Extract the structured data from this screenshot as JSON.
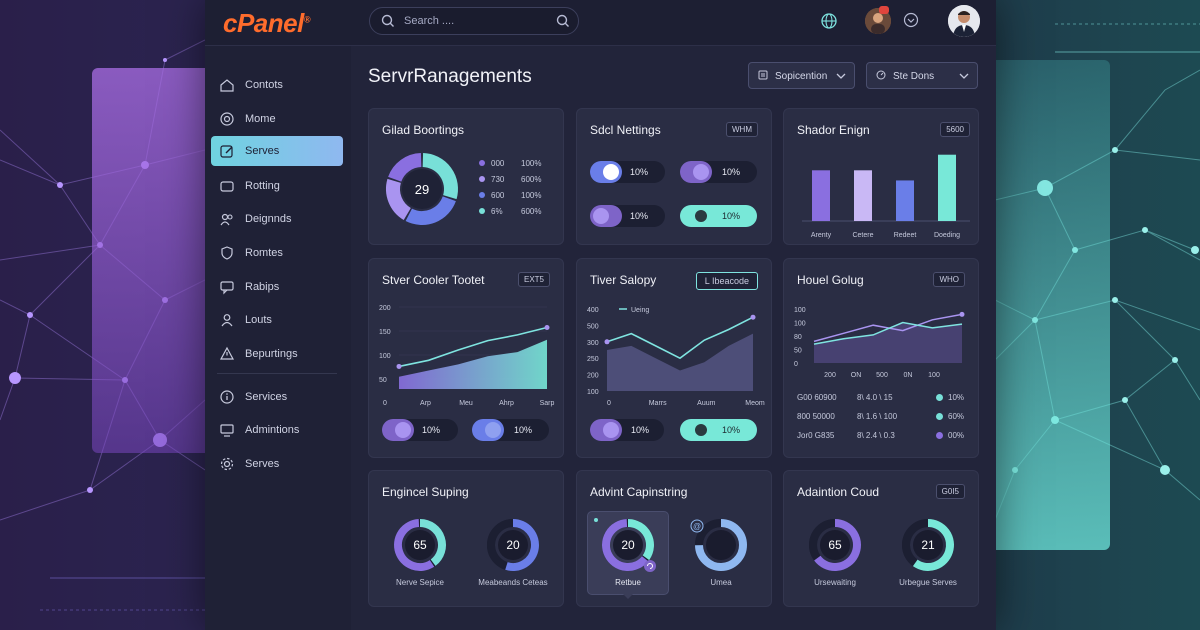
{
  "app": {
    "logo": "cPanel"
  },
  "search": {
    "placeholder": "Search ...."
  },
  "sidebar": {
    "items": [
      {
        "label": "Contots",
        "icon": "home-icon"
      },
      {
        "label": "Mome",
        "icon": "target-icon"
      },
      {
        "label": "Serves",
        "icon": "edit-icon",
        "active": true
      },
      {
        "label": "Rotting",
        "icon": "folder-icon"
      },
      {
        "label": "Deignnds",
        "icon": "people-icon"
      },
      {
        "label": "Romtes",
        "icon": "shield-icon"
      },
      {
        "label": "Rabips",
        "icon": "chat-icon"
      },
      {
        "label": "Louts",
        "icon": "user-icon"
      },
      {
        "label": "Bepurtings",
        "icon": "warning-icon"
      },
      {
        "label": "Services",
        "icon": "info-icon"
      },
      {
        "label": "Admintions",
        "icon": "monitor-icon"
      },
      {
        "label": "Serves",
        "icon": "gear-icon"
      }
    ]
  },
  "header": {
    "title": "ServrRanagements",
    "dropdown1": "Sopicention",
    "dropdown2": "Ste Dons"
  },
  "cards": {
    "c1": {
      "title": "Gilad Boortings",
      "center": "29",
      "legend": [
        {
          "a": "000",
          "b": "100%",
          "color": "#8a6fe0"
        },
        {
          "a": "730",
          "b": "600%",
          "color": "#a994f0"
        },
        {
          "a": "600",
          "b": "100%",
          "color": "#6a7ee8"
        },
        {
          "a": "6%",
          "b": "600%",
          "color": "#78e0d8"
        }
      ],
      "donut": [
        0.3,
        0.28,
        0.22,
        0.2
      ]
    },
    "c2": {
      "title": "Sdcl Nettings",
      "badge": "WHM",
      "toggles": [
        "10%",
        "10%",
        "10%",
        "10%"
      ]
    },
    "c3": {
      "title": "Shador Enign",
      "badge": "5600",
      "chart_data": {
        "type": "bar",
        "categories": [
          "Arenty",
          "Cetere",
          "Redeet",
          "Doeding"
        ],
        "values": [
          65,
          65,
          52,
          85
        ],
        "ylim": [
          0,
          100
        ]
      }
    },
    "c4": {
      "title": "Stver Cooler Tootet",
      "badge": "EXT5",
      "chart_data": {
        "type": "area",
        "yticks": [
          "200",
          "150",
          "100",
          "50"
        ],
        "xticks": [
          "0",
          "Arp",
          "Meu",
          "Ahrp",
          "Sarp"
        ],
        "line": [
          55,
          70,
          95,
          118,
          132,
          150
        ],
        "area": [
          30,
          45,
          60,
          80,
          90,
          120
        ],
        "ylim": [
          0,
          200
        ]
      },
      "toggles": [
        "10%",
        "10%"
      ]
    },
    "c5": {
      "title": "Tiver Salopy",
      "badge": "L Ibeacode",
      "chart_data": {
        "type": "area",
        "yticks": [
          "400",
          "500",
          "300",
          "250",
          "200",
          "100"
        ],
        "xticks": [
          "0",
          "Marrs",
          "Auum",
          "Meom"
        ],
        "legend": "Ueing",
        "line": [
          60,
          70,
          55,
          40,
          62,
          75,
          90
        ],
        "area": [
          50,
          55,
          40,
          25,
          35,
          55,
          70
        ]
      },
      "toggles": [
        "10%",
        "10%"
      ]
    },
    "c6": {
      "title": "Houel Golug",
      "badge": "WHO",
      "chart_data": {
        "type": "line",
        "yticks": [
          "100",
          "100",
          "80",
          "50",
          "0"
        ],
        "xticks": [
          "200",
          "ON",
          "500",
          "0N",
          "100"
        ],
        "line1": [
          40,
          55,
          70,
          60,
          80,
          90
        ],
        "line2": [
          35,
          45,
          52,
          75,
          65,
          72
        ]
      },
      "rows": [
        {
          "a": "G00 60900",
          "b": "8\\ 4.0 \\ 15",
          "c": "10%",
          "color": "#78e0d8"
        },
        {
          "a": "800 50000",
          "b": "8\\ 1.6 \\ 100",
          "c": "60%",
          "color": "#78e0d8"
        },
        {
          "a": "Jor0 G835",
          "b": "8\\ 2.4 \\ 0.3",
          "c": "00%",
          "color": "#8a6fe0"
        }
      ]
    },
    "c7": {
      "title": "Engincel Suping",
      "gauges": [
        {
          "value": "65",
          "label": "Nerve Sepice"
        },
        {
          "value": "20",
          "label": "Meabeands Ceteas"
        }
      ]
    },
    "c8": {
      "title": "Advint Capinstring",
      "gauges": [
        {
          "value": "20",
          "label": "Retbue"
        },
        {
          "value": "",
          "label": "Umea"
        }
      ]
    },
    "c9": {
      "title": "Adaintion Coud",
      "badge": "G0I5",
      "gauges": [
        {
          "value": "65",
          "label": "Ursewaiting"
        },
        {
          "value": "21",
          "label": "Urbegue Serves"
        }
      ]
    }
  },
  "colors": {
    "accent_purple": "#8a6fe0",
    "accent_teal": "#78e0d8",
    "logo_orange": "#ff6c2c"
  }
}
